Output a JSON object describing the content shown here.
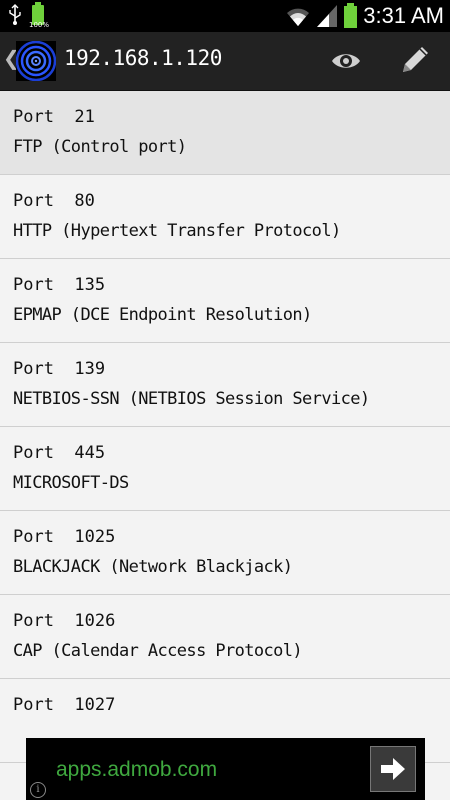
{
  "status_bar": {
    "time": "3:31 AM",
    "battery_small_label": "100%",
    "icons": [
      "usb-icon",
      "battery-full-icon",
      "wifi-icon",
      "signal-icon",
      "battery-icon"
    ]
  },
  "action_bar": {
    "title": "192.168.1.120",
    "back_glyph": "❮",
    "actions": [
      "eye-icon",
      "pencil-icon"
    ]
  },
  "ports": [
    {
      "port": "Port  21",
      "desc": "FTP (Control port)"
    },
    {
      "port": "Port  80",
      "desc": "HTTP (Hypertext Transfer Protocol)"
    },
    {
      "port": "Port  135",
      "desc": "EPMAP (DCE Endpoint Resolution)"
    },
    {
      "port": "Port  139",
      "desc": "NETBIOS-SSN (NETBIOS Session Service)"
    },
    {
      "port": "Port  445",
      "desc": "MICROSOFT-DS"
    },
    {
      "port": "Port  1025",
      "desc": "BLACKJACK (Network Blackjack)"
    },
    {
      "port": "Port  1026",
      "desc": "CAP (Calendar Access Protocol)"
    },
    {
      "port": "Port  1027",
      "desc": ""
    }
  ],
  "ad": {
    "text": "apps.admob.com",
    "info_glyph": "i",
    "accent": "#3fa83f"
  },
  "colors": {
    "status_bar_bg": "#000000",
    "action_bar_bg": "#222222",
    "list_bg": "#f3f3f3",
    "selected_row_bg": "#e4e4e4",
    "battery_green": "#6fd13b"
  }
}
